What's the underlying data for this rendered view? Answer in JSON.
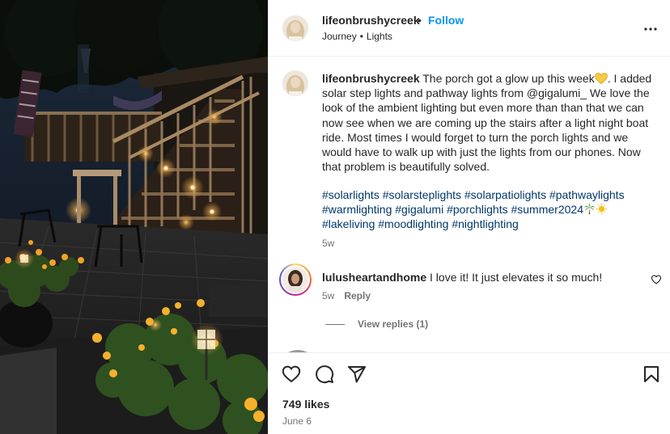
{
  "header": {
    "username": "lifeonbrushycreek",
    "separator": "•",
    "follow_label": "Follow",
    "audio": "Journey",
    "audio_separator": "•",
    "location": "Lights",
    "more_icon": "more-horizontal-icon"
  },
  "caption": {
    "username": "lifeonbrushycreek",
    "text_before_emoji": "The porch got a glow up this week",
    "emoji_name": "yellow-heart-icon",
    "text_after_emoji": ". I added solar step lights and pathway lights from @gigalumi_ We love the look of the ambient lighting but even more than than that we can now see when we are coming up the stairs after a light night boat ride. Most times I would forget to turn the porch lights and we would have to walk up with just the lights from our phones. Now that problem is beautifully solved.",
    "hashtags": [
      "#solarlights",
      "#solarsteplights",
      "#solarpatiolights",
      "#pathwaylights",
      "#warmlighting",
      "#gigalumi",
      "#porchlights",
      "#summer2024",
      "#lakeliving",
      "#moodlighting",
      "#nightlighting"
    ],
    "hashtag_emojis": [
      "palm-tree-icon",
      "sun-icon"
    ],
    "time": "5w"
  },
  "comment": {
    "username": "lulusheartandhome",
    "text": "I love it! It just elevates it so much!",
    "time": "5w",
    "reply_label": "Reply",
    "view_replies": "View replies (1)"
  },
  "actions": {
    "icons": [
      "heart-icon",
      "comment-icon",
      "share-icon",
      "bookmark-icon"
    ],
    "likes": "749 likes",
    "date": "June 6"
  },
  "colors": {
    "link_blue": "#0095f6",
    "hashtag_blue": "#00376b",
    "secondary_text": "#737373",
    "primary_text": "#262626"
  }
}
